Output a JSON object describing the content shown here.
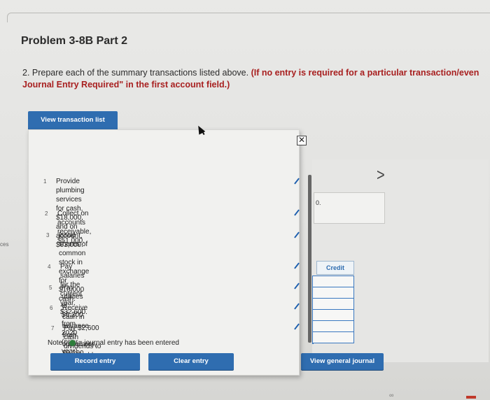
{
  "title": "Problem 3-8B Part 2",
  "instructions": {
    "line1_normal": "2. Prepare each of the summary transactions listed above.",
    "line1_red": "(If no entry is required for a particular transaction/even",
    "line2_red": "Journal Entry Required\" in the first account field.)"
  },
  "side_word": "ces",
  "buttons": {
    "view_transaction_list": "View transaction list",
    "record_entry": "Record entry",
    "clear_entry": "Clear entry",
    "view_general_journal": "View general journal"
  },
  "popup": {
    "close_glyph": "✕",
    "transactions": [
      {
        "num": "1",
        "line1": "Provide plumbing services for cash, $18,000, and on",
        "line2": "account, $63,000."
      },
      {
        "num": "2",
        "line1": "Collect on accounts receivable, $51,000.",
        "line2": ""
      },
      {
        "num": "3",
        "line1": "Issue shares of common stock in exchange for $10,000",
        "line2": "cash."
      },
      {
        "num": "4",
        "line1": "Pay salaries for the current year, $32,600.",
        "line2": ""
      },
      {
        "num": "5",
        "line1": "Pay utilities of $6,200 from 2020 (prior year).",
        "line2": ""
      },
      {
        "num": "6",
        "line1": "Receive cash in advance from customers, $9,200.",
        "line2": ""
      },
      {
        "num": "7",
        "line1": "Pay $2,600 cash dividends to stockholders.",
        "line2": ""
      }
    ],
    "note_label": "Note :",
    "note_text": "= journal entry has been entered"
  },
  "journal": {
    "chevron": ">",
    "partial_value": "0.",
    "credit_header": "Credit"
  },
  "colors": {
    "accent_blue": "#2f6db0",
    "check_blue": "#1d5fae",
    "note_dot_green": "#2d7d3a",
    "instruction_red": "#a82020"
  }
}
